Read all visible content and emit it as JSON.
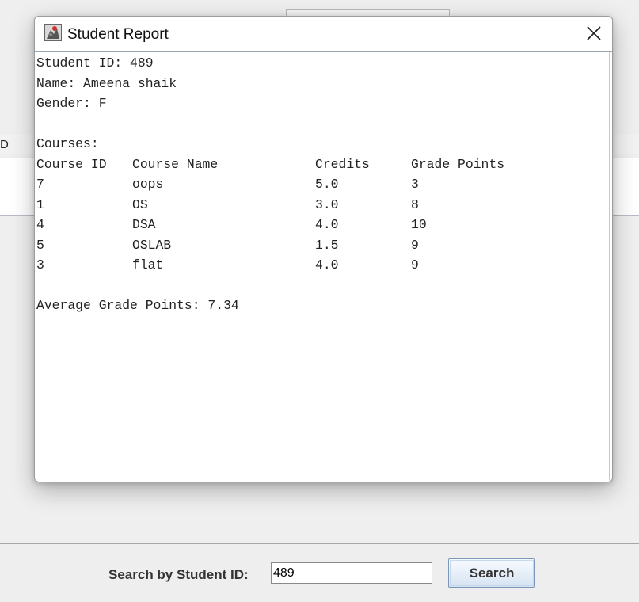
{
  "main": {
    "table_header_partial": "D",
    "search": {
      "label": "Search by Student ID:",
      "value": "489",
      "button_label": "Search"
    }
  },
  "dialog": {
    "title": "Student Report",
    "icon": "java-app-icon",
    "report": {
      "student_id_line": "Student ID: 489",
      "name_line": "Name: Ameena shaik",
      "gender_line": "Gender: F",
      "courses_heading": "Courses:",
      "columns": [
        "Course ID",
        "Course Name",
        "Credits",
        "Grade Points"
      ],
      "courses": [
        {
          "id": "7",
          "name": "oops",
          "credits": "5.0",
          "grade_points": "3"
        },
        {
          "id": "1",
          "name": "OS",
          "credits": "3.0",
          "grade_points": "8"
        },
        {
          "id": "4",
          "name": "DSA",
          "credits": "4.0",
          "grade_points": "10"
        },
        {
          "id": "5",
          "name": "OSLAB",
          "credits": "1.5",
          "grade_points": "9"
        },
        {
          "id": "3",
          "name": "flat",
          "credits": "4.0",
          "grade_points": "9"
        }
      ],
      "average_line": "Average Grade Points: 7.34"
    }
  }
}
